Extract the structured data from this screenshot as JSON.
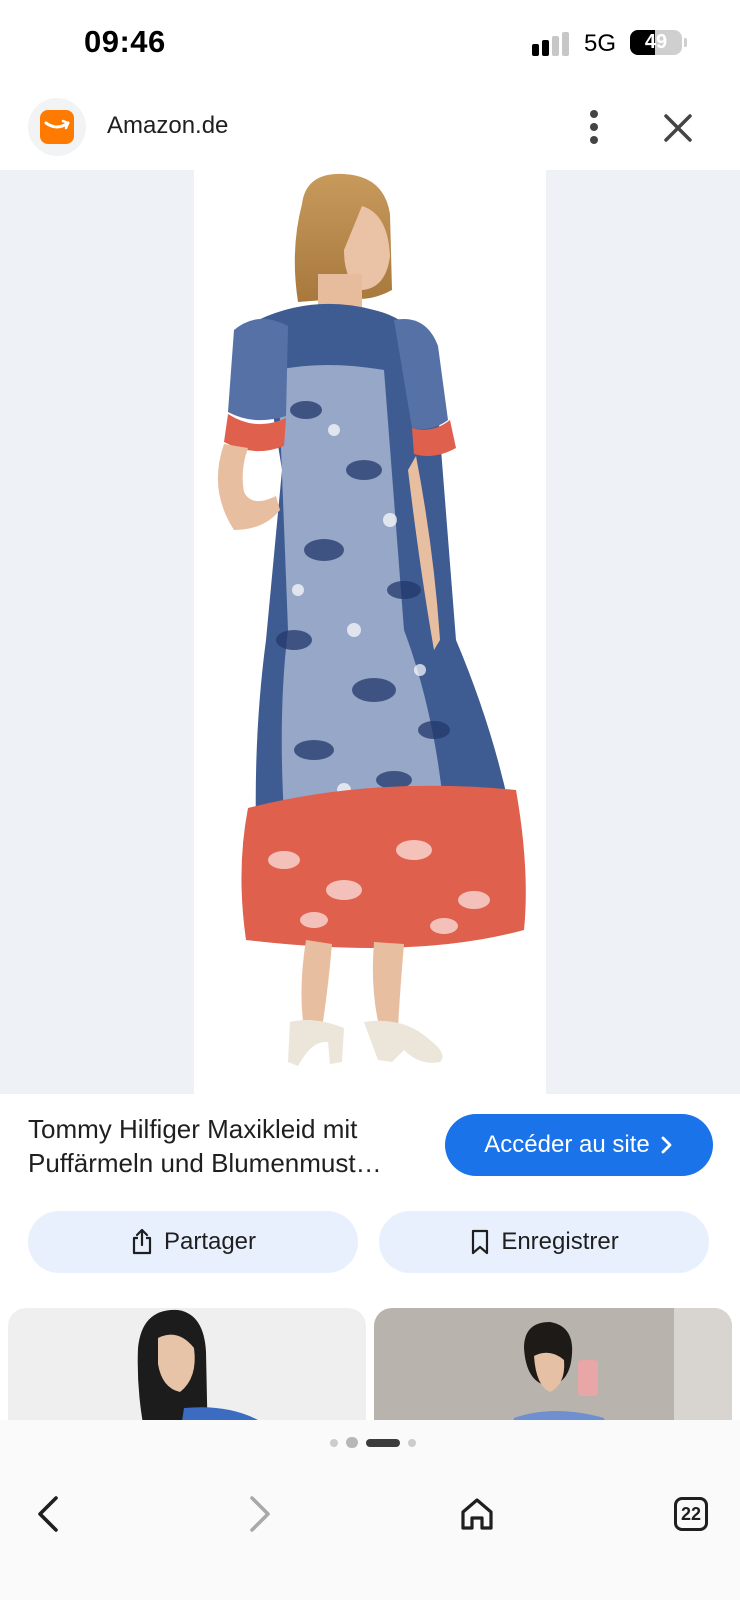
{
  "status_bar": {
    "time": "09:46",
    "network": "5G",
    "battery": "49",
    "battery_level": 0.49
  },
  "header": {
    "site_name": "Amazon.de",
    "favicon": "amazon-smile-icon",
    "more_icon": "more-vert-icon",
    "close_icon": "close-icon"
  },
  "product": {
    "title": "Tommy Hilfiger Maxikleid mit Puffärmeln und Blumenmust…",
    "visit_label": "Accéder au site",
    "visit_icon": "chevron-right-icon"
  },
  "actions": {
    "share_label": "Partager",
    "share_icon": "share-icon",
    "save_label": "Enregistrer",
    "save_icon": "bookmark-icon"
  },
  "pagination": {
    "total": 5,
    "active": 3
  },
  "nav": {
    "back_icon": "back-arrow-icon",
    "forward_icon": "forward-arrow-icon",
    "home_icon": "home-icon",
    "tabs_count": "22"
  },
  "colors": {
    "accent": "#1a73e8",
    "pill": "#e8f0fe",
    "image_bg": "#eef1f6",
    "brand": "#ff7a00"
  }
}
